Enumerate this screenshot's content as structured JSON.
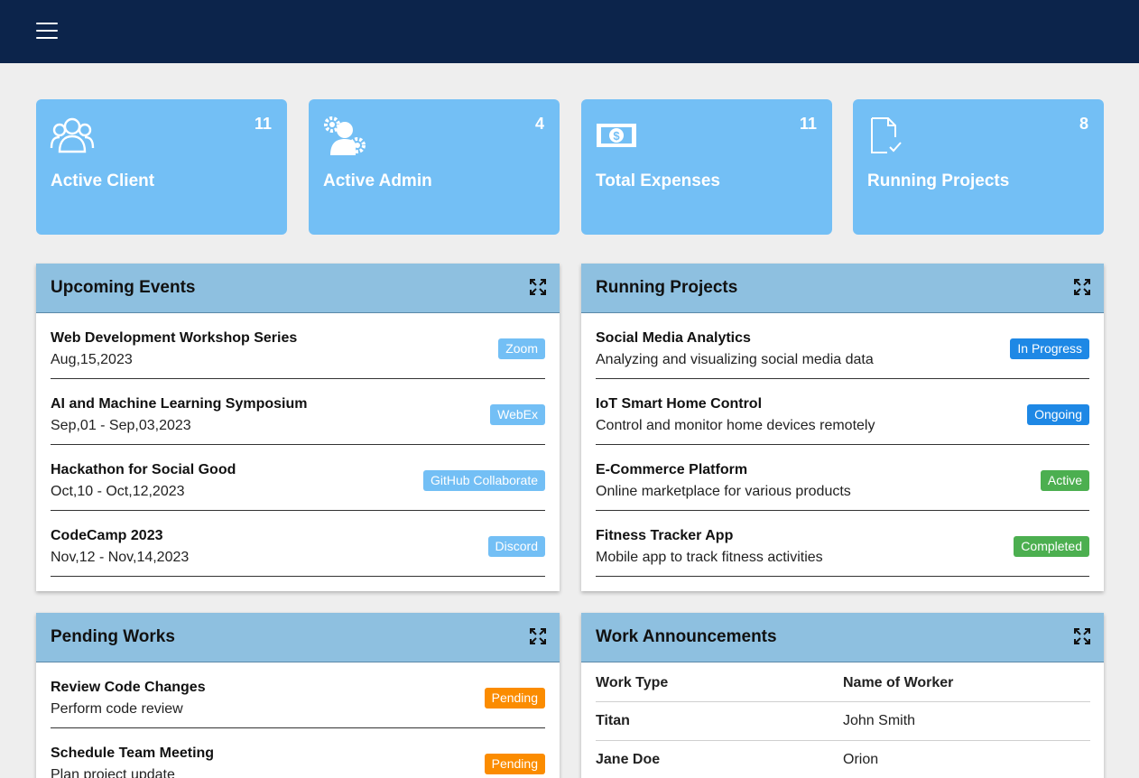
{
  "stats": [
    {
      "label": "Active Client",
      "count": "11",
      "icon": "users-icon"
    },
    {
      "label": "Active Admin",
      "count": "4",
      "icon": "admin-gear-icon"
    },
    {
      "label": "Total Expenses",
      "count": "11",
      "icon": "money-icon"
    },
    {
      "label": "Running Projects",
      "count": "8",
      "icon": "document-check-icon"
    }
  ],
  "upcoming_events": {
    "title": "Upcoming Events",
    "items": [
      {
        "title": "Web Development Workshop Series",
        "date": "Aug,15,2023",
        "badge": "Zoom"
      },
      {
        "title": "AI and Machine Learning Symposium",
        "date": "Sep,01 - Sep,03,2023",
        "badge": "WebEx"
      },
      {
        "title": "Hackathon for Social Good",
        "date": "Oct,10 - Oct,12,2023",
        "badge": "GitHub Collaborate"
      },
      {
        "title": "CodeCamp 2023",
        "date": "Nov,12 - Nov,14,2023",
        "badge": "Discord"
      }
    ]
  },
  "running_projects": {
    "title": "Running Projects",
    "items": [
      {
        "title": "Social Media Analytics",
        "desc": "Analyzing and visualizing social media data",
        "badge": "In Progress",
        "color": "#1e88e5"
      },
      {
        "title": "IoT Smart Home Control",
        "desc": "Control and monitor home devices remotely",
        "badge": "Ongoing",
        "color": "#1e88e5"
      },
      {
        "title": "E-Commerce Platform",
        "desc": "Online marketplace for various products",
        "badge": "Active",
        "color": "#4caf50"
      },
      {
        "title": "Fitness Tracker App",
        "desc": "Mobile app to track fitness activities",
        "badge": "Completed",
        "color": "#4caf50"
      }
    ]
  },
  "pending_works": {
    "title": "Pending Works",
    "items": [
      {
        "title": "Review Code Changes",
        "desc": "Perform code review",
        "badge": "Pending"
      },
      {
        "title": "Schedule Team Meeting",
        "desc": "Plan project update",
        "badge": "Pending"
      }
    ]
  },
  "work_announcements": {
    "title": "Work Announcements",
    "headers": [
      "Work Type",
      "Name of Worker"
    ],
    "rows": [
      [
        "Titan",
        "John Smith"
      ],
      [
        "Jane Doe",
        "Orion"
      ]
    ]
  },
  "colors": {
    "topbar": "#0c244b",
    "stat_card": "#73bff5",
    "panel_header": "#8ec0e0",
    "event_badge": "#73bff5",
    "pending_badge": "#fb8c00"
  }
}
